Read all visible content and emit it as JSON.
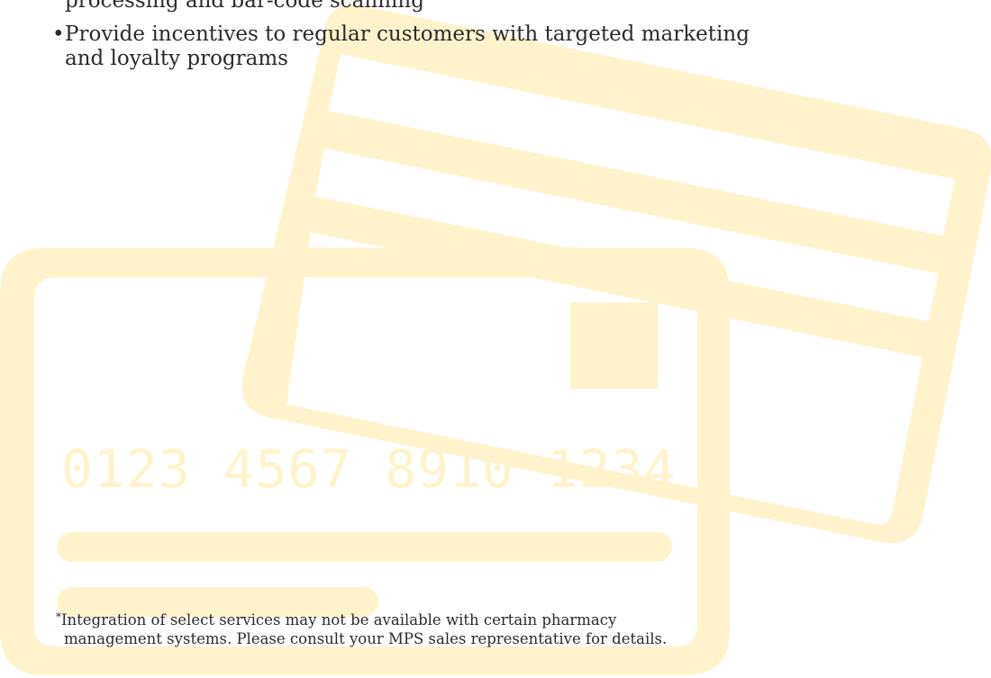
{
  "bullets": [
    {
      "text": "processing and bar-code scanning",
      "has_dot": false
    },
    {
      "text": "Provide incentives to regular customers with targeted marketing",
      "line2": "and loyalty programs",
      "has_dot": true
    }
  ],
  "card": {
    "number": "0123 4567 8910 1234",
    "color": "#FFF3CC"
  },
  "footnote": {
    "marker": "*",
    "line1": "Integration of select services may not be available with certain pharmacy",
    "line2": "management systems. Please consult your MPS sales representative for details."
  }
}
